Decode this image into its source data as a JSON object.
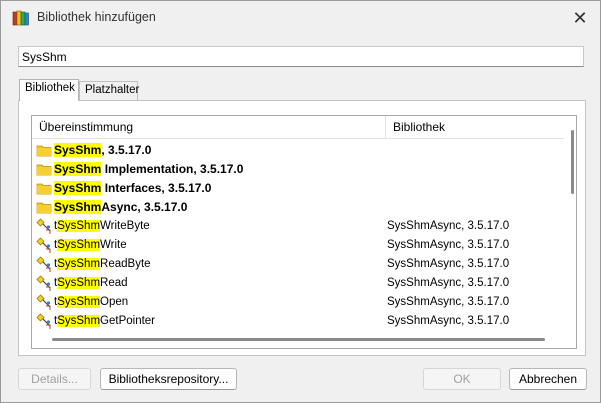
{
  "window": {
    "title": "Bibliothek hinzufügen",
    "close_glyph": "✕"
  },
  "search": {
    "value": "SysShm"
  },
  "tabs": [
    {
      "label": "Bibliothek",
      "active": true
    },
    {
      "label": "Platzhalter",
      "active": false
    }
  ],
  "list": {
    "columns": [
      "Übereinstimmung",
      "Bibliothek"
    ],
    "rows": [
      {
        "pre": "",
        "hl": "SysShm",
        "post": ", 3.5.17.0",
        "lib": "",
        "bold": true,
        "icon": "folder-icon"
      },
      {
        "pre": "",
        "hl": "SysShm",
        "post": " Implementation, 3.5.17.0",
        "lib": "",
        "bold": true,
        "icon": "folder-icon"
      },
      {
        "pre": "",
        "hl": "SysShm",
        "post": " Interfaces, 3.5.17.0",
        "lib": "",
        "bold": true,
        "icon": "folder-icon"
      },
      {
        "pre": "",
        "hl": "SysShm",
        "post": "Async, 3.5.17.0",
        "lib": "",
        "bold": true,
        "icon": "folder-icon"
      },
      {
        "pre": "t",
        "hl": "SysShm",
        "post": "WriteByte",
        "lib": "SysShmAsync, 3.5.17.0",
        "bold": false,
        "icon": "function-block-icon"
      },
      {
        "pre": "t",
        "hl": "SysShm",
        "post": "Write",
        "lib": "SysShmAsync, 3.5.17.0",
        "bold": false,
        "icon": "function-block-icon"
      },
      {
        "pre": "t",
        "hl": "SysShm",
        "post": "ReadByte",
        "lib": "SysShmAsync, 3.5.17.0",
        "bold": false,
        "icon": "function-block-icon"
      },
      {
        "pre": "t",
        "hl": "SysShm",
        "post": "Read",
        "lib": "SysShmAsync, 3.5.17.0",
        "bold": false,
        "icon": "function-block-icon"
      },
      {
        "pre": "t",
        "hl": "SysShm",
        "post": "Open",
        "lib": "SysShmAsync, 3.5.17.0",
        "bold": false,
        "icon": "function-block-icon"
      },
      {
        "pre": "t",
        "hl": "SysShm",
        "post": "GetPointer",
        "lib": "SysShmAsync, 3.5.17.0",
        "bold": false,
        "icon": "function-block-icon"
      }
    ]
  },
  "buttons": {
    "details": "Details...",
    "repository": "Bibliotheksrepository...",
    "ok": "OK",
    "cancel": "Abbrechen"
  },
  "colors": {
    "highlight": "#ffff00",
    "folder": "#f5c518"
  }
}
